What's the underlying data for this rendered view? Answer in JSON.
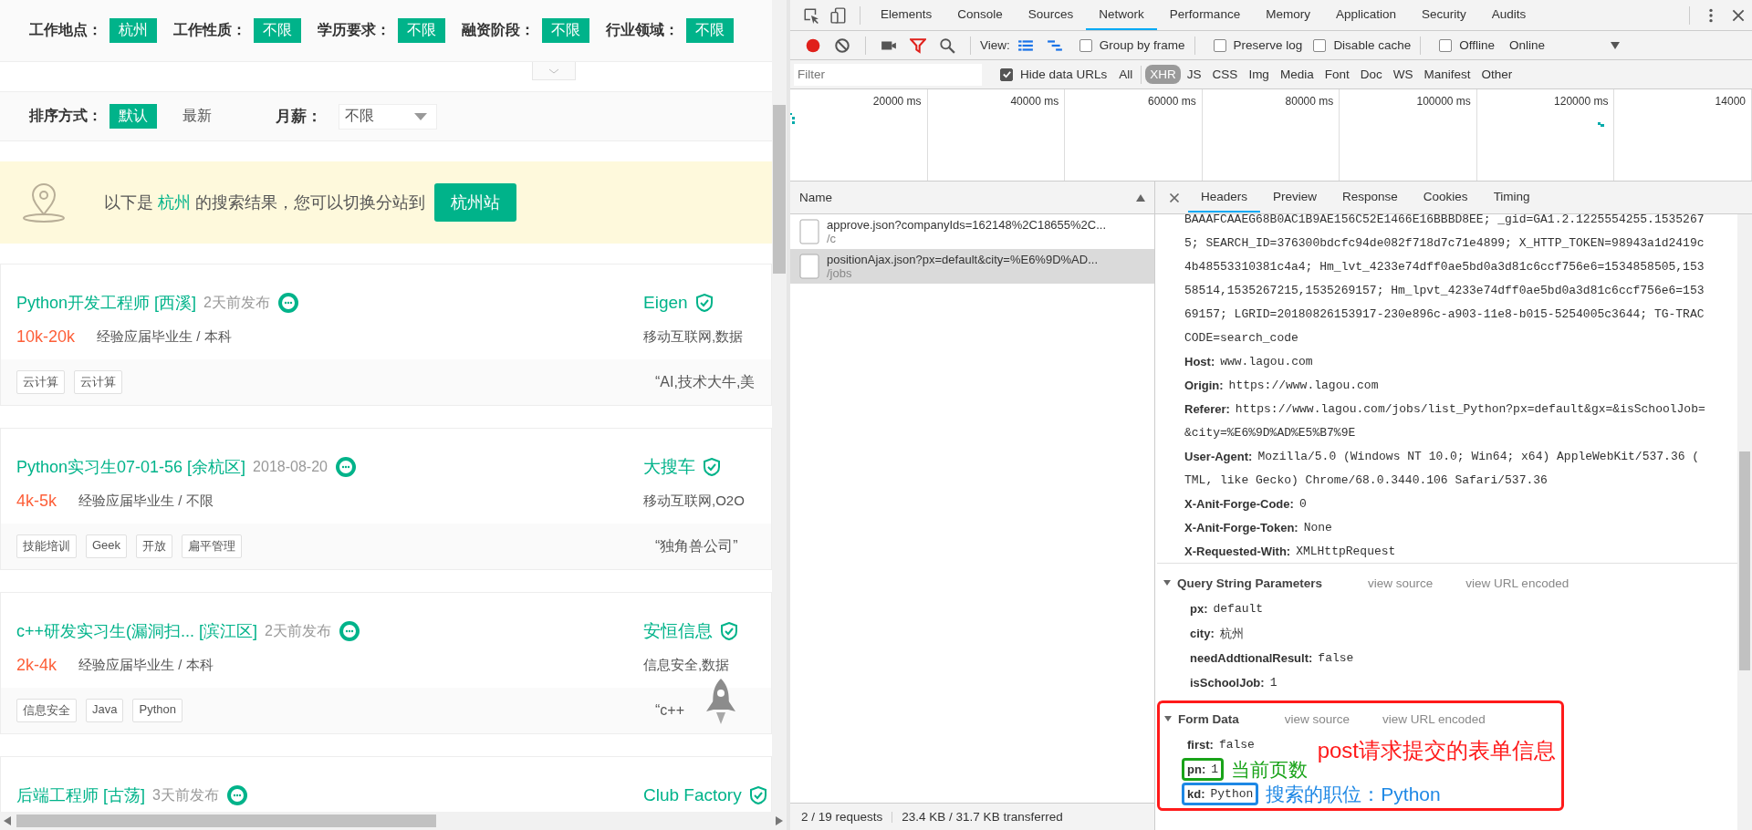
{
  "page": {
    "filters": [
      {
        "label": "工作地点：",
        "value": "杭州"
      },
      {
        "label": "工作性质：",
        "value": "不限"
      },
      {
        "label": "学历要求：",
        "value": "不限"
      },
      {
        "label": "融资阶段：",
        "value": "不限"
      },
      {
        "label": "行业领域：",
        "value": "不限"
      }
    ],
    "sort": {
      "label": "排序方式：",
      "options": [
        {
          "label": "默认",
          "selected": true
        },
        {
          "label": "最新",
          "selected": false
        }
      ],
      "salary_label": "月薪：",
      "salary_value": "不限"
    },
    "banner": {
      "prefix": "以下是 ",
      "city": "杭州",
      "suffix": " 的搜索结果，您可以切换分站到",
      "button": "杭州站"
    },
    "jobs": [
      {
        "title": "Python开发工程师 [西溪]",
        "posted": "2天前发布",
        "salary": "10k-20k",
        "requirement": "经验应届毕业生 / 本科",
        "tags": [
          "云计算",
          "云计算"
        ],
        "company": "Eigen",
        "industry": "移动互联网,数据",
        "slogan": "“AI,技术大牛,美"
      },
      {
        "title": "Python实习生07-01-56 [余杭区]",
        "posted": "2018-08-20",
        "salary": "4k-5k",
        "requirement": "经验应届毕业生 / 不限",
        "tags": [
          "技能培训",
          "Geek",
          "开放",
          "扁平管理"
        ],
        "company": "大搜车",
        "industry": "移动互联网,O2O",
        "slogan": "“独角兽公司”"
      },
      {
        "title": "c++研发实习生(漏洞扫... [滨江区]",
        "posted": "2天前发布",
        "salary": "2k-4k",
        "requirement": "经验应届毕业生 / 本科",
        "tags": [
          "信息安全",
          "Java",
          "Python"
        ],
        "company": "安恒信息",
        "industry": "信息安全,数据",
        "slogan": "“c++"
      },
      {
        "title": "后端工程师 [古荡]",
        "posted": "3天前发布",
        "company": "Club Factory"
      }
    ]
  },
  "devtools": {
    "tabs": [
      {
        "label": "Elements",
        "selected": false
      },
      {
        "label": "Console",
        "selected": false
      },
      {
        "label": "Sources",
        "selected": false
      },
      {
        "label": "Network",
        "selected": true
      },
      {
        "label": "Performance",
        "selected": false
      },
      {
        "label": "Memory",
        "selected": false
      },
      {
        "label": "Application",
        "selected": false
      },
      {
        "label": "Security",
        "selected": false
      },
      {
        "label": "Audits",
        "selected": false
      }
    ],
    "toolbar": {
      "recording": true,
      "filter_active": true,
      "view_label": "View:",
      "options": [
        {
          "label": "Group by frame",
          "checked": false
        },
        {
          "label": "Preserve log",
          "checked": false
        },
        {
          "label": "Disable cache",
          "checked": false
        },
        {
          "label": "Offline",
          "checked": false
        }
      ],
      "throttle": "Online"
    },
    "filter_bar": {
      "placeholder": "Filter",
      "hide_data_urls": {
        "label": "Hide data URLs",
        "checked": true
      },
      "types": [
        {
          "label": "All",
          "selected": false
        },
        {
          "label": "XHR",
          "selected": true
        },
        {
          "label": "JS",
          "selected": false
        },
        {
          "label": "CSS",
          "selected": false
        },
        {
          "label": "Img",
          "selected": false
        },
        {
          "label": "Media",
          "selected": false
        },
        {
          "label": "Font",
          "selected": false
        },
        {
          "label": "Doc",
          "selected": false
        },
        {
          "label": "WS",
          "selected": false
        },
        {
          "label": "Manifest",
          "selected": false
        },
        {
          "label": "Other",
          "selected": false
        }
      ]
    },
    "overview": {
      "ticks": [
        "20000 ms",
        "40000 ms",
        "60000 ms",
        "80000 ms",
        "100000 ms",
        "120000 ms",
        "14000"
      ]
    },
    "requests": {
      "header": "Name",
      "rows": [
        {
          "name": "approve.json?companyIds=162148%2C18655%2C...",
          "path": "/c",
          "selected": false
        },
        {
          "name": "positionAjax.json?px=default&city=%E6%9D%AD...",
          "path": "/jobs",
          "selected": true
        }
      ]
    },
    "status": {
      "requests": "2 / 19 requests",
      "transferred": "23.4 KB / 31.7 KB transferred"
    },
    "details": {
      "tabs": [
        {
          "label": "Headers",
          "selected": true
        },
        {
          "label": "Preview",
          "selected": false
        },
        {
          "label": "Response",
          "selected": false
        },
        {
          "label": "Cookies",
          "selected": false
        },
        {
          "label": "Timing",
          "selected": false
        }
      ],
      "cookie_lines": [
        "BAAAFCAAEG68B0AC1B9AE156C52E1466E16BBBD8EE; _gid=GA1.2.1225554255.1535267",
        "5; SEARCH_ID=376300bdcfc94de082f718d7c71e4899; X_HTTP_TOKEN=98943a1d2419c",
        "4b48553310381c4a4; Hm_lvt_4233e74dff0ae5bd0a3d81c6ccf756e6=1534858505,153",
        "58514,1535267215,1535269157; Hm_lpvt_4233e74dff0ae5bd0a3d81c6ccf756e6=153",
        "69157; LGRID=20180826153917-230e896c-a903-11e8-b015-5254005c3644; TG-TRAC",
        "CODE=search_code"
      ],
      "headers": [
        {
          "name": "Host:",
          "value_lines": [
            "www.lagou.com"
          ]
        },
        {
          "name": "Origin:",
          "value_lines": [
            "https://www.lagou.com"
          ]
        },
        {
          "name": "Referer:",
          "value_lines": [
            "https://www.lagou.com/jobs/list_Python?px=default&gx=&isSchoolJob=",
            "&city=%E6%9D%AD%E5%B7%9E"
          ]
        },
        {
          "name": "User-Agent:",
          "value_lines": [
            "Mozilla/5.0 (Windows NT 10.0; Win64; x64) AppleWebKit/537.36 (",
            "TML, like Gecko) Chrome/68.0.3440.106 Safari/537.36"
          ]
        },
        {
          "name": "X-Anit-Forge-Code:",
          "value_lines": [
            "0"
          ]
        },
        {
          "name": "X-Anit-Forge-Token:",
          "value_lines": [
            "None"
          ]
        },
        {
          "name": "X-Requested-With:",
          "value_lines": [
            "XMLHttpRequest"
          ]
        }
      ],
      "query": {
        "title": "Query String Parameters",
        "expanded": true,
        "view_source": "view source",
        "view_url_encoded": "view URL encoded",
        "params": [
          {
            "name": "px:",
            "value": "default"
          },
          {
            "name": "city:",
            "value": "杭州"
          },
          {
            "name": "needAddtionalResult:",
            "value": "false"
          },
          {
            "name": "isSchoolJob:",
            "value": "1"
          }
        ]
      },
      "form_data": {
        "title": "Form Data",
        "expanded": true,
        "view_source": "view source",
        "view_url_encoded": "view URL encoded",
        "note": "post请求提交的表单信息",
        "params": [
          {
            "name": "first:",
            "value": "false"
          },
          {
            "name": "pn:",
            "value": "1",
            "color": "#19a319",
            "note": "当前页数"
          },
          {
            "name": "kd:",
            "value": "Python",
            "color": "#1e88e5",
            "note": "搜索的职位：Python"
          }
        ]
      }
    }
  }
}
